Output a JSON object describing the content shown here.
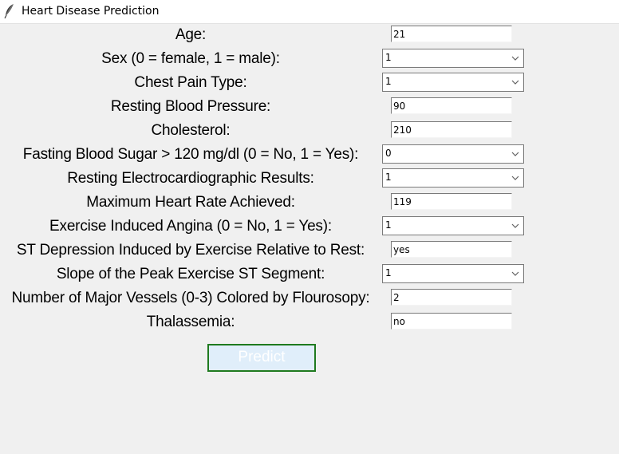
{
  "window": {
    "title": "Heart Disease Prediction",
    "icon": "feather-icon"
  },
  "form": {
    "fields": [
      {
        "label": "Age:",
        "widget": "entry",
        "value": "21"
      },
      {
        "label": "Sex (0 = female, 1 = male):",
        "widget": "combobox",
        "value": "1"
      },
      {
        "label": "Chest Pain Type:",
        "widget": "combobox",
        "value": "1"
      },
      {
        "label": "Resting Blood Pressure:",
        "widget": "entry",
        "value": "90"
      },
      {
        "label": "Cholesterol:",
        "widget": "entry",
        "value": "210"
      },
      {
        "label": "Fasting Blood Sugar > 120 mg/dl (0 = No, 1 = Yes):",
        "widget": "combobox",
        "value": "0"
      },
      {
        "label": "Resting Electrocardiographic Results:",
        "widget": "combobox",
        "value": "1"
      },
      {
        "label": "Maximum Heart Rate Achieved:",
        "widget": "entry",
        "value": "119"
      },
      {
        "label": "Exercise Induced Angina (0 = No, 1 = Yes):",
        "widget": "combobox",
        "value": "1"
      },
      {
        "label": "ST Depression Induced by Exercise Relative to Rest:",
        "widget": "entry",
        "value": "yes"
      },
      {
        "label": "Slope of the Peak Exercise ST Segment:",
        "widget": "combobox",
        "value": "1"
      },
      {
        "label": "Number of Major Vessels (0-3) Colored by Flourosopy:",
        "widget": "entry",
        "value": "2"
      },
      {
        "label": "Thalassemia:",
        "widget": "entry",
        "value": "no"
      }
    ],
    "predict_label": "Predict"
  },
  "colors": {
    "window_background": "#f0f0f0",
    "button_background": "#e0eefa",
    "button_border": "#1f7a1f",
    "button_text": "#ffffff"
  }
}
